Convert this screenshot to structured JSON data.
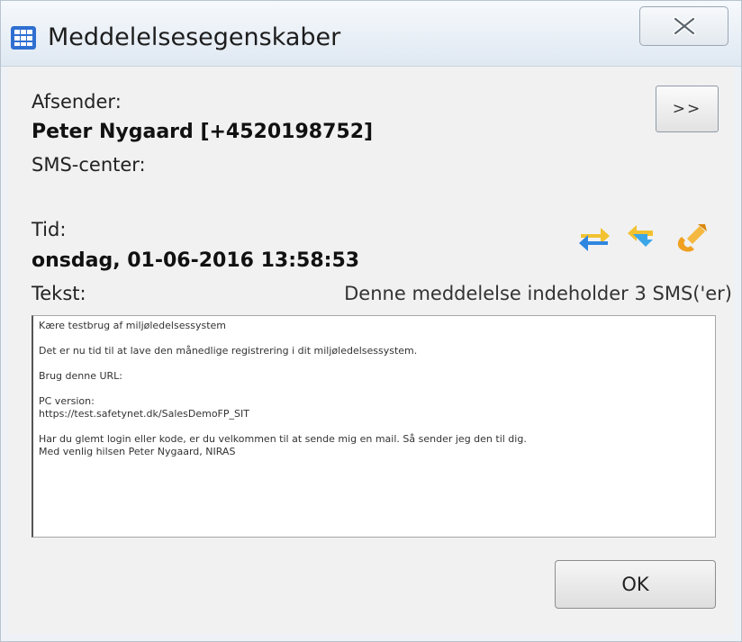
{
  "window": {
    "title": "Meddelelsesegenskaber"
  },
  "sender": {
    "label": "Afsender:",
    "value": "Peter Nygaard [+4520198752]",
    "sms_center_label": "SMS-center:"
  },
  "time": {
    "label": "Tid:",
    "value": "onsdag, 01-06-2016 13:58:53"
  },
  "text": {
    "label": "Tekst:",
    "sms_count": "Denne meddelelse indeholder 3 SMS('er)",
    "paragraphs": [
      "Kære testbrug af miljøledelsessystem",
      "Det er nu tid til at lave den månedlige registrering i dit miljøledelsessystem.",
      "Brug denne URL:",
      "PC version:\nhttps://test.safetynet.dk/SalesDemoFP_SIT",
      "Har du glemt login eller kode, er du velkommen til at sende mig en mail. Så sender jeg den til dig.\nMed venlig hilsen Peter Nygaard, NIRAS"
    ]
  },
  "buttons": {
    "expand": ">>",
    "ok": "OK"
  },
  "icons": {
    "app": "grid-icon",
    "close": "close-icon",
    "forward": "forward-icon",
    "reply": "reply-icon",
    "call": "phone-icon"
  },
  "colors": {
    "app_icon": "#2f6fd1",
    "forward_arrow": "#2f86e0",
    "reply_arrow": "#3aa6e8",
    "phone": "#f0a020"
  }
}
